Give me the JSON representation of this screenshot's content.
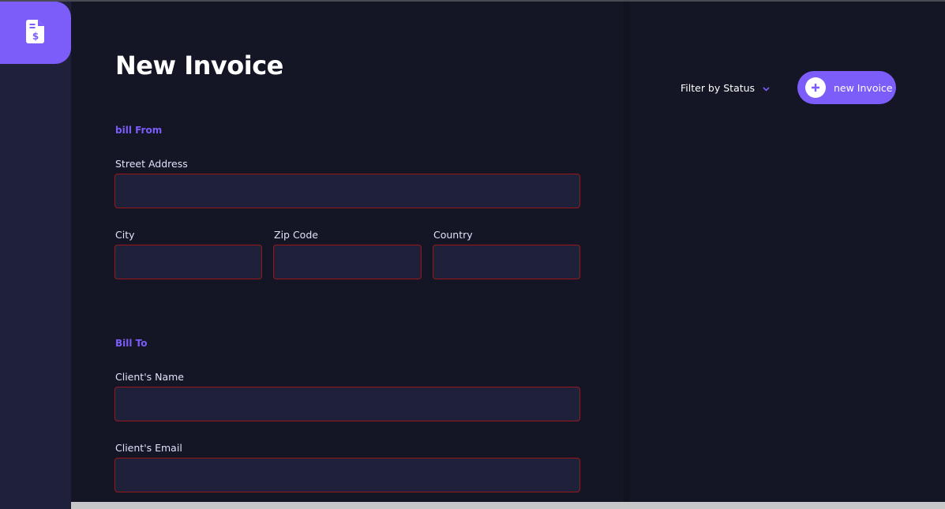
{
  "sidebar": {
    "logo_icon": "invoice-dollar-icon",
    "accent": "#7c5dfa"
  },
  "form": {
    "title": "New Invoice",
    "bill_from": {
      "heading": "bill From",
      "street_label": "Street Address",
      "street_value": "",
      "city_label": "City",
      "city_value": "",
      "zip_label": "Zip Code",
      "zip_value": "",
      "country_label": "Country",
      "country_value": ""
    },
    "bill_to": {
      "heading": "Bill To",
      "client_name_label": "Client's Name",
      "client_name_value": "",
      "client_email_label": "Client's Email",
      "client_email_value": ""
    }
  },
  "header": {
    "filter_label": "Filter by Status",
    "filter_icon": "chevron-down-icon",
    "new_invoice_label": "new Invoice",
    "new_invoice_icon": "plus-icon"
  },
  "colors": {
    "background": "#141625",
    "panel": "#1e2139",
    "accent": "#7c5dfa",
    "error_border": "#9b1818"
  }
}
